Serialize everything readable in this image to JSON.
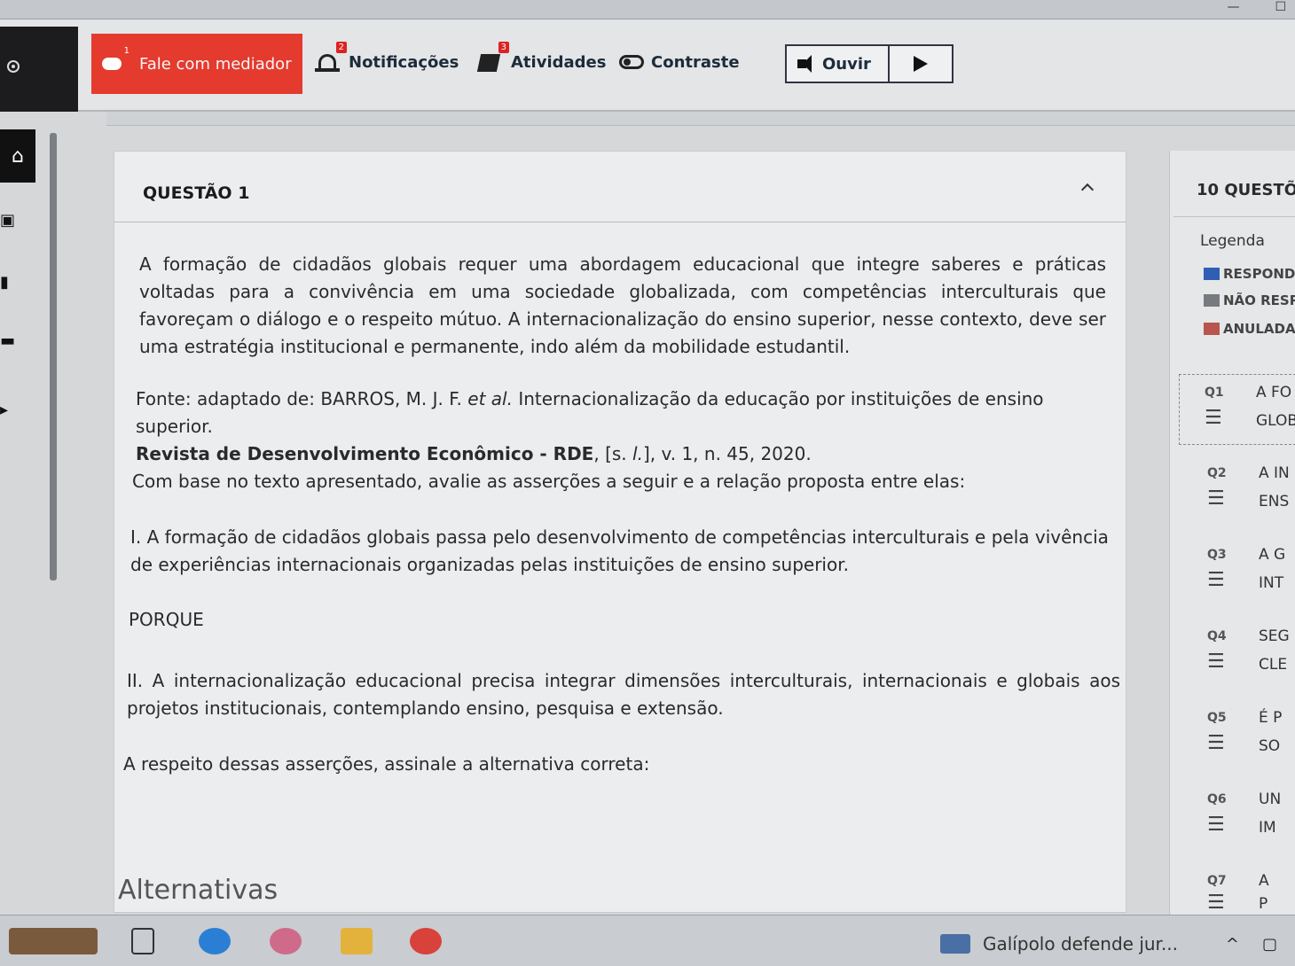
{
  "toolbar": {
    "mediator_label": "Fale com mediador",
    "mediator_badge": "1",
    "notifications_label": "Notificações",
    "notifications_badge": "2",
    "activities_label": "Atividades",
    "activities_badge": "3",
    "contrast_label": "Contraste",
    "listen_label": "Ouvir"
  },
  "question": {
    "title": "QUESTÃO 1",
    "paragraph1": "A formação de cidadãos globais requer uma abordagem educacional que integre saberes e práticas voltadas para a convivência em uma sociedade globalizada, com competências interculturais que favoreçam o diálogo e o respeito mútuo. A internacionalização do ensino superior, nesse contexto, deve ser uma estratégia institucional e permanente, indo além da mobilidade estudantil.",
    "source_line1_a": "Fonte: adaptado de: BARROS, M. J. F. ",
    "source_line1_etal": "et al.",
    "source_line1_b": " Internacionalização da educação por instituições de ensino superior.",
    "source_journal": "Revista de Desenvolvimento Econômico - RDE",
    "source_line2_a": ", [s. ",
    "source_line2_l": "l.",
    "source_line2_b": "], v. 1, n. 45, 2020.",
    "prompt": "Com base no texto apresentado, avalie as asserções a seguir e a relação proposta entre elas:",
    "assertion1": "I. A formação de cidadãos globais passa pelo desenvolvimento de competências interculturais e pela vivência de experiências internacionais organizadas pelas instituições de ensino superior.",
    "connector": "PORQUE",
    "assertion2": "II. A internacionalização educacional precisa integrar dimensões interculturais, internacionais e globais aos projetos institucionais, contemplando ensino, pesquisa e extensão.",
    "instruction": "A respeito dessas asserções, assinale a alternativa correta:",
    "alternatives_title": "Alternativas"
  },
  "question_panel": {
    "title": "10 QUESTÕ",
    "legend_label": "Legenda",
    "legend": [
      {
        "label": "RESPOND",
        "color": "#2f5fb5"
      },
      {
        "label": "NÃO RESP",
        "color": "#777b80"
      },
      {
        "label": "ANULADA",
        "color": "#b8554f"
      }
    ],
    "items": [
      {
        "num": "Q1",
        "t1": "A FO",
        "t2": "GLOB"
      },
      {
        "num": "Q2",
        "t1": "A IN",
        "t2": "ENS"
      },
      {
        "num": "Q3",
        "t1": "A G",
        "t2": "INT"
      },
      {
        "num": "Q4",
        "t1": "SEG",
        "t2": "CLE"
      },
      {
        "num": "Q5",
        "t1": "É P",
        "t2": "SO"
      },
      {
        "num": "Q6",
        "t1": "UN",
        "t2": "IM"
      },
      {
        "num": "Q7",
        "t1": "A",
        "t2": "P"
      }
    ]
  },
  "taskbar": {
    "news_text": "Galípolo defende jur..."
  }
}
